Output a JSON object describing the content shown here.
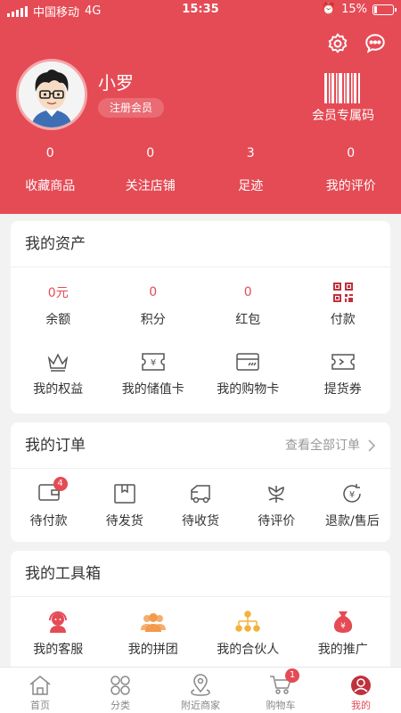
{
  "status_bar": {
    "carrier": "中国移动",
    "network": "4G",
    "time": "15:35",
    "battery": "15%",
    "battery_level": 0.15
  },
  "profile": {
    "name": "小罗",
    "member_level": "注册会员",
    "member_code_label": "会员专属码"
  },
  "stats": [
    {
      "value": "0",
      "label": "收藏商品"
    },
    {
      "value": "0",
      "label": "关注店铺"
    },
    {
      "value": "3",
      "label": "足迹"
    },
    {
      "value": "0",
      "label": "我的评价"
    }
  ],
  "assets": {
    "title": "我的资产",
    "top_row": [
      {
        "value": "0元",
        "label": "余额"
      },
      {
        "value": "0",
        "label": "积分"
      },
      {
        "value": "0",
        "label": "红包"
      },
      {
        "icon": "qr-code-icon",
        "label": "付款"
      }
    ],
    "bottom_row": [
      {
        "icon": "crown-icon",
        "label": "我的权益"
      },
      {
        "icon": "stored-value-card-icon",
        "label": "我的储值卡"
      },
      {
        "icon": "shopping-card-icon",
        "label": "我的购物卡"
      },
      {
        "icon": "voucher-icon",
        "label": "提货券"
      }
    ]
  },
  "orders": {
    "title": "我的订单",
    "view_all": "查看全部订单",
    "items": [
      {
        "icon": "wallet-icon",
        "label": "待付款",
        "badge": "4"
      },
      {
        "icon": "package-icon",
        "label": "待发货"
      },
      {
        "icon": "truck-icon",
        "label": "待收货"
      },
      {
        "icon": "flower-icon",
        "label": "待评价"
      },
      {
        "icon": "refund-icon",
        "label": "退款/售后"
      }
    ]
  },
  "toolbox": {
    "title": "我的工具箱",
    "items": [
      {
        "icon": "customer-service-icon",
        "label": "我的客服",
        "color": "#e54b55"
      },
      {
        "icon": "group-buy-icon",
        "label": "我的拼团",
        "color": "#f39a4c"
      },
      {
        "icon": "partner-icon",
        "label": "我的合伙人",
        "color": "#f2b23a"
      },
      {
        "icon": "promotion-bag-icon",
        "label": "我的推广",
        "color": "#e54b55"
      }
    ]
  },
  "tabbar": [
    {
      "icon": "home-icon",
      "label": "首页"
    },
    {
      "icon": "category-icon",
      "label": "分类"
    },
    {
      "icon": "location-icon",
      "label": "附近商家"
    },
    {
      "icon": "cart-icon",
      "label": "购物车",
      "badge": "1"
    },
    {
      "icon": "user-icon",
      "label": "我的",
      "active": true
    }
  ],
  "colors": {
    "brand": "#e54b55",
    "background": "#f2f2f2"
  }
}
